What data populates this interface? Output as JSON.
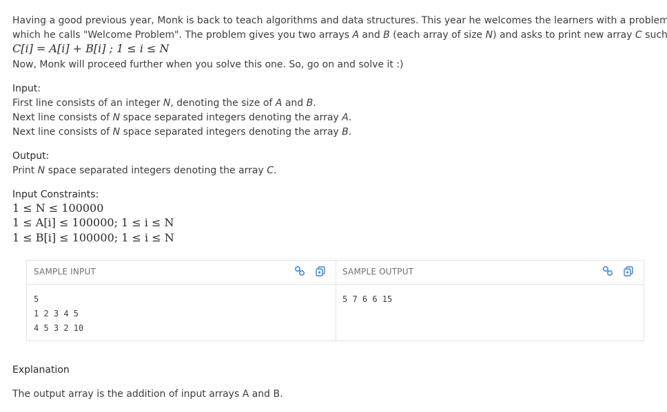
{
  "statement": {
    "p1_line1": "Having a good previous year, Monk is back to teach algorithms and data structures. This year he welcomes the learners with a problem",
    "p1_line2_a": "which he calls \"Welcome Problem\". The problem gives you two arrays ",
    "var_A": "A",
    "and": " and ",
    "var_B": "B",
    "p1_line2_b": " (each array of size ",
    "var_N": "N",
    "p1_line2_c": ") and asks to print new array ",
    "var_C": "C",
    "p1_line2_d": " such that:",
    "formula": "C[i] = A[i] + B[i] ; 1 ≤ i ≤ N",
    "p2": "Now, Monk will proceed further when you solve this one. So, go on and solve it :)"
  },
  "input": {
    "heading": "Input:",
    "l1_a": "First line consists of an integer ",
    "l1_N": "N",
    "l1_b": ", denoting the size of ",
    "l1_A": "A",
    "l1_and": " and ",
    "l1_B": "B",
    "l1_end": ".",
    "l2_a": "Next line consists of ",
    "l2_N": "N",
    "l2_b": " space separated integers denoting the array ",
    "l2_A": "A",
    "l2_end": ".",
    "l3_a": "Next line consists of ",
    "l3_N": "N",
    "l3_b": " space separated integers denoting the array ",
    "l3_B": "B",
    "l3_end": "."
  },
  "output": {
    "heading": "Output:",
    "l1_a": "Print ",
    "l1_N": "N",
    "l1_b": " space separated integers denoting the array ",
    "l1_C": "C",
    "l1_end": "."
  },
  "constraints": {
    "heading": "Input Constraints:",
    "c1": "1 ≤ N ≤ 100000",
    "c2": "1 ≤ A[i] ≤ 100000; 1 ≤ i ≤ N",
    "c3": "1 ≤ B[i] ≤ 100000; 1 ≤ i ≤ N"
  },
  "samples": {
    "input_label": "SAMPLE INPUT",
    "output_label": "SAMPLE OUTPUT",
    "input_text": "5\n1 2 3 4 5\n4 5 3 2 10",
    "output_text": "5 7 6 6 15",
    "icons": [
      "link-icon",
      "copy-icon"
    ],
    "accent": "#3a7fd5"
  },
  "explanation": {
    "heading": "Explanation",
    "text": "The output array is the addition of input arrays A and B."
  }
}
